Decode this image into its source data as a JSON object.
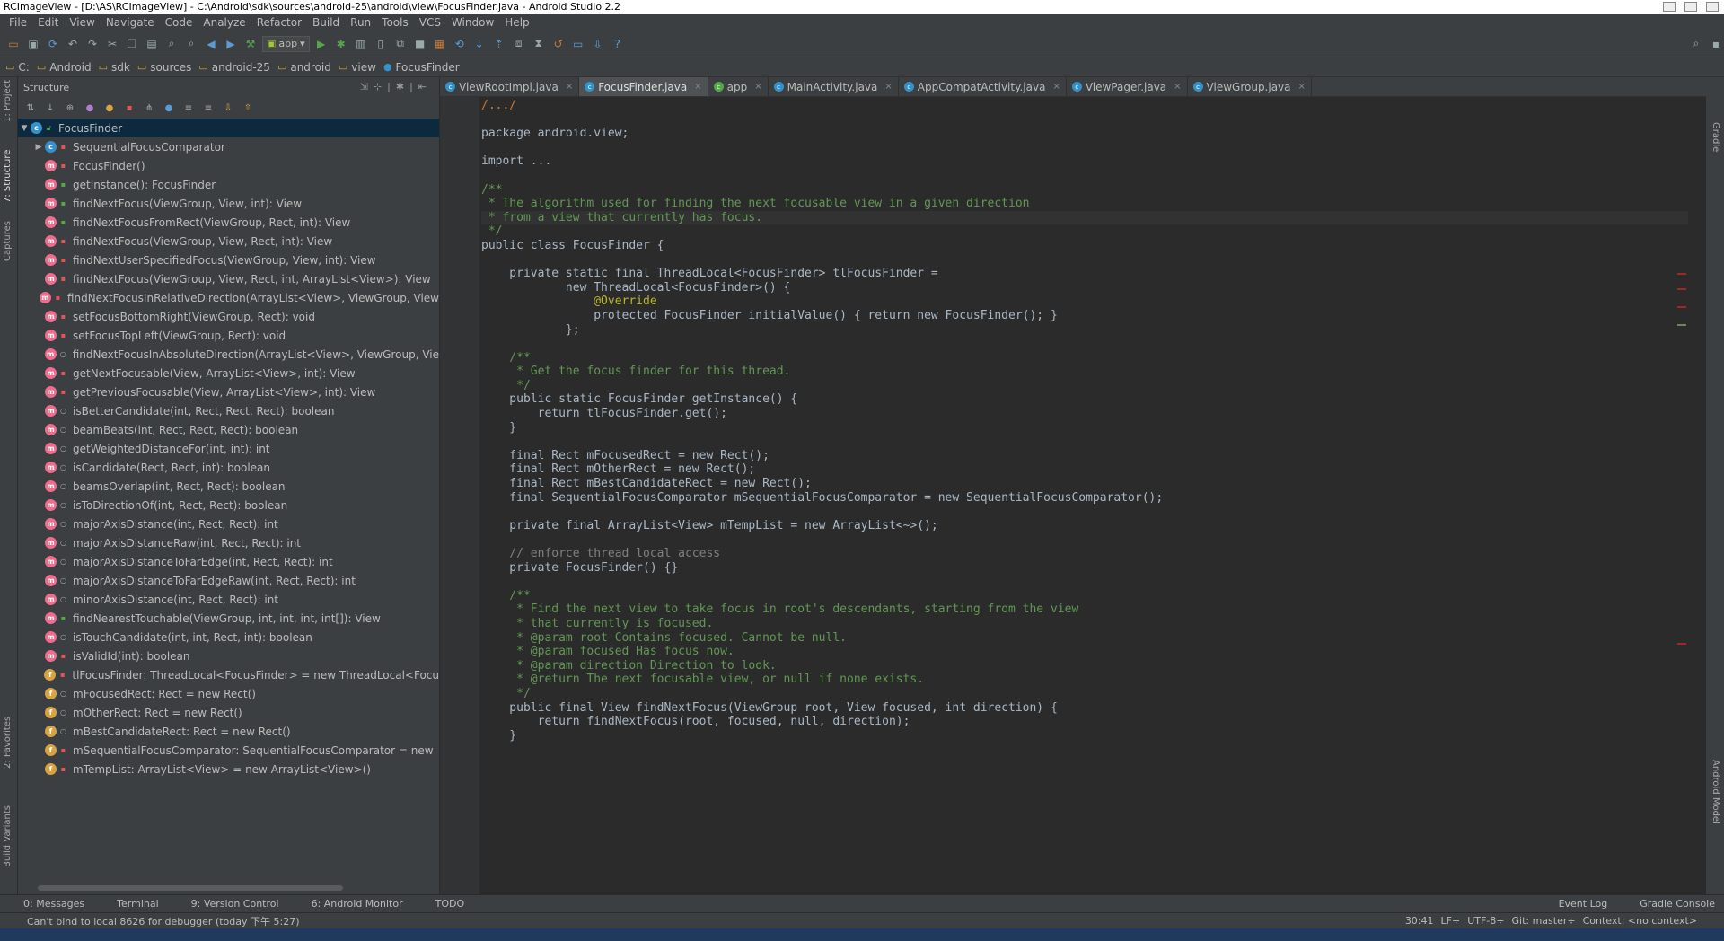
{
  "window": {
    "title": "RCImageView - [D:\\AS\\RCImageView] - C:\\Android\\sdk\\sources\\android-25\\android\\view\\FocusFinder.java - Android Studio 2.2"
  },
  "menu": [
    "File",
    "Edit",
    "View",
    "Navigate",
    "Code",
    "Analyze",
    "Refactor",
    "Build",
    "Run",
    "Tools",
    "VCS",
    "Window",
    "Help"
  ],
  "toolbar": {
    "run_config": "app"
  },
  "breadcrumbs": [
    "C:",
    "Android",
    "sdk",
    "sources",
    "android-25",
    "android",
    "view",
    "FocusFinder"
  ],
  "left_strip": {
    "project": "1: Project",
    "structure": "7: Structure",
    "captures": "Captures",
    "favorites": "2: Favorites",
    "build_variants": "Build Variants"
  },
  "structure": {
    "title": "Structure",
    "root": "FocusFinder",
    "items": [
      {
        "label": "SequentialFocusComparator",
        "kind": "c",
        "vis": "priv",
        "arrow": true
      },
      {
        "label": "FocusFinder()",
        "kind": "m",
        "vis": "priv"
      },
      {
        "label": "getInstance(): FocusFinder",
        "kind": "m",
        "vis": "pub"
      },
      {
        "label": "findNextFocus(ViewGroup, View, int): View",
        "kind": "m",
        "vis": "pub"
      },
      {
        "label": "findNextFocusFromRect(ViewGroup, Rect, int): View",
        "kind": "m",
        "vis": "pub"
      },
      {
        "label": "findNextFocus(ViewGroup, View, Rect, int): View",
        "kind": "m",
        "vis": "priv"
      },
      {
        "label": "findNextUserSpecifiedFocus(ViewGroup, View, int): View",
        "kind": "m",
        "vis": "priv"
      },
      {
        "label": "findNextFocus(ViewGroup, View, Rect, int, ArrayList<View>): View",
        "kind": "m",
        "vis": "priv"
      },
      {
        "label": "findNextFocusInRelativeDirection(ArrayList<View>, ViewGroup, View",
        "kind": "m",
        "vis": "priv"
      },
      {
        "label": "setFocusBottomRight(ViewGroup, Rect): void",
        "kind": "m",
        "vis": "priv"
      },
      {
        "label": "setFocusTopLeft(ViewGroup, Rect): void",
        "kind": "m",
        "vis": "priv"
      },
      {
        "label": "findNextFocusInAbsoluteDirection(ArrayList<View>, ViewGroup, Vie",
        "kind": "m",
        "vis": "pk"
      },
      {
        "label": "getNextFocusable(View, ArrayList<View>, int): View",
        "kind": "m",
        "vis": "priv"
      },
      {
        "label": "getPreviousFocusable(View, ArrayList<View>, int): View",
        "kind": "m",
        "vis": "priv"
      },
      {
        "label": "isBetterCandidate(int, Rect, Rect, Rect): boolean",
        "kind": "m",
        "vis": "pk"
      },
      {
        "label": "beamBeats(int, Rect, Rect, Rect): boolean",
        "kind": "m",
        "vis": "pk"
      },
      {
        "label": "getWeightedDistanceFor(int, int): int",
        "kind": "m",
        "vis": "pk"
      },
      {
        "label": "isCandidate(Rect, Rect, int): boolean",
        "kind": "m",
        "vis": "pk"
      },
      {
        "label": "beamsOverlap(int, Rect, Rect): boolean",
        "kind": "m",
        "vis": "pk"
      },
      {
        "label": "isToDirectionOf(int, Rect, Rect): boolean",
        "kind": "m",
        "vis": "pk"
      },
      {
        "label": "majorAxisDistance(int, Rect, Rect): int",
        "kind": "m",
        "vis": "pk"
      },
      {
        "label": "majorAxisDistanceRaw(int, Rect, Rect): int",
        "kind": "m",
        "vis": "pk"
      },
      {
        "label": "majorAxisDistanceToFarEdge(int, Rect, Rect): int",
        "kind": "m",
        "vis": "pk"
      },
      {
        "label": "majorAxisDistanceToFarEdgeRaw(int, Rect, Rect): int",
        "kind": "m",
        "vis": "pk"
      },
      {
        "label": "minorAxisDistance(int, Rect, Rect): int",
        "kind": "m",
        "vis": "pk"
      },
      {
        "label": "findNearestTouchable(ViewGroup, int, int, int, int[]): View",
        "kind": "m",
        "vis": "pub"
      },
      {
        "label": "isTouchCandidate(int, int, Rect, int): boolean",
        "kind": "m",
        "vis": "pk"
      },
      {
        "label": "isValidId(int): boolean",
        "kind": "m",
        "vis": "priv"
      },
      {
        "label": "tlFocusFinder: ThreadLocal<FocusFinder> = new ThreadLocal<Focu",
        "kind": "f",
        "vis": "priv"
      },
      {
        "label": "mFocusedRect: Rect = new Rect()",
        "kind": "f",
        "vis": "pk"
      },
      {
        "label": "mOtherRect: Rect = new Rect()",
        "kind": "f",
        "vis": "pk"
      },
      {
        "label": "mBestCandidateRect: Rect = new Rect()",
        "kind": "f",
        "vis": "pk"
      },
      {
        "label": "mSequentialFocusComparator: SequentialFocusComparator = new",
        "kind": "f",
        "vis": "priv"
      },
      {
        "label": "mTempList: ArrayList<View> = new ArrayList<View>()",
        "kind": "f",
        "vis": "priv"
      }
    ]
  },
  "editor_tabs": [
    {
      "label": "ViewRootImpl.java",
      "active": false
    },
    {
      "label": "FocusFinder.java",
      "active": true
    },
    {
      "label": "app",
      "active": false
    },
    {
      "label": "MainActivity.java",
      "active": false
    },
    {
      "label": "AppCompatActivity.java",
      "active": false
    },
    {
      "label": "ViewPager.java",
      "active": false
    },
    {
      "label": "ViewGroup.java",
      "active": false
    }
  ],
  "code_lines": [
    "/.../",
    "",
    "package android.view;",
    "",
    "import ...",
    "",
    "/**",
    " * The algorithm used for finding the next focusable view in a given direction",
    " * from a view that currently has focus.",
    " */",
    "public class FocusFinder {",
    "",
    "    private static final ThreadLocal<FocusFinder> tlFocusFinder =",
    "            new ThreadLocal<FocusFinder>() {",
    "                @Override",
    "                protected FocusFinder initialValue() { return new FocusFinder(); }",
    "            };",
    "",
    "    /**",
    "     * Get the focus finder for this thread.",
    "     */",
    "    public static FocusFinder getInstance() {",
    "        return tlFocusFinder.get();",
    "    }",
    "",
    "    final Rect mFocusedRect = new Rect();",
    "    final Rect mOtherRect = new Rect();",
    "    final Rect mBestCandidateRect = new Rect();",
    "    final SequentialFocusComparator mSequentialFocusComparator = new SequentialFocusComparator();",
    "",
    "    private final ArrayList<View> mTempList = new ArrayList<~>();",
    "",
    "    // enforce thread local access",
    "    private FocusFinder() {}",
    "",
    "    /**",
    "     * Find the next view to take focus in root's descendants, starting from the view",
    "     * that currently is focused.",
    "     * @param root Contains focused. Cannot be null.",
    "     * @param focused Has focus now.",
    "     * @param direction Direction to look.",
    "     * @return The next focusable view, or null if none exists.",
    "     */",
    "    public final View findNextFocus(ViewGroup root, View focused, int direction) {",
    "        return findNextFocus(root, focused, null, direction);",
    "    }"
  ],
  "right_strip": {
    "gradle": "Gradle",
    "android_model": "Android Model"
  },
  "bottom_tabs": {
    "messages": "0: Messages",
    "terminal": "Terminal",
    "vcs": "9: Version Control",
    "monitor": "6: Android Monitor",
    "todo": "TODO",
    "event_log": "Event Log",
    "gradle_console": "Gradle Console"
  },
  "status": {
    "message": "Can't bind to local 8626 for debugger (today 下午 5:27)",
    "position": "30:41",
    "line_sep": "LF÷",
    "encoding": "UTF-8÷",
    "git": "Git: master÷",
    "context": "Context: <no context>"
  },
  "colors": {
    "bg": "#2b2b2b",
    "panel": "#3c3f41",
    "keyword": "#cc7832",
    "doc": "#629755",
    "static_field": "#9876aa",
    "method": "#ffc66d",
    "selection": "#0d293e"
  }
}
